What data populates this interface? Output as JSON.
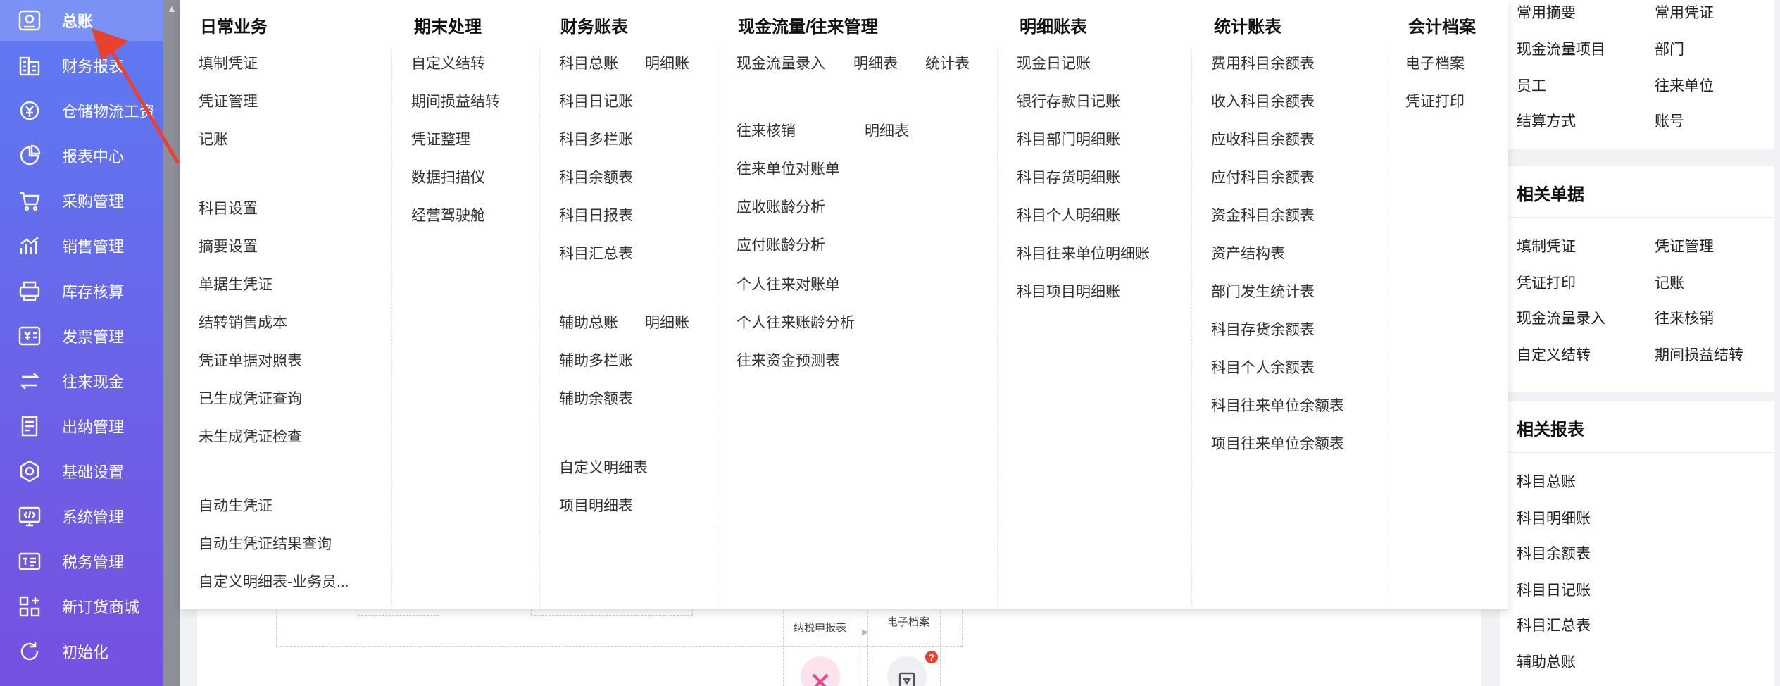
{
  "sidebar": {
    "items": [
      {
        "label": "总账",
        "icon": "ledger-icon"
      },
      {
        "label": "财务报表",
        "icon": "building-icon"
      },
      {
        "label": "仓储物流工资",
        "icon": "yen-gear-icon"
      },
      {
        "label": "报表中心",
        "icon": "pie-chart-icon"
      },
      {
        "label": "采购管理",
        "icon": "cart-icon"
      },
      {
        "label": "销售管理",
        "icon": "trend-chart-icon"
      },
      {
        "label": "库存核算",
        "icon": "printer-icon"
      },
      {
        "label": "发票管理",
        "icon": "invoice-icon"
      },
      {
        "label": "往来现金",
        "icon": "exchange-icon"
      },
      {
        "label": "出纳管理",
        "icon": "document-icon"
      },
      {
        "label": "基础设置",
        "icon": "gear-icon"
      },
      {
        "label": "系统管理",
        "icon": "monitor-code-icon"
      },
      {
        "label": "税务管理",
        "icon": "tax-icon"
      },
      {
        "label": "新订货商城",
        "icon": "apps-plus-icon"
      },
      {
        "label": "初始化",
        "icon": "refresh-icon"
      }
    ],
    "active_color": "#5d7cf3",
    "end_color": "#7650e0"
  },
  "mega_menu": {
    "daily": {
      "title": "日常业务",
      "links": [
        "填制凭证",
        "凭证管理",
        "记账",
        "科目设置",
        "摘要设置",
        "单据生凭证",
        "结转销售成本",
        "凭证单据对照表",
        "已生成凭证查询",
        "未生成凭证检查",
        "自动生凭证",
        "自动生凭证结果查询",
        "自定义明细表-业务员..."
      ]
    },
    "period_end": {
      "title": "期末处理",
      "links": [
        "自定义结转",
        "期间损益结转",
        "凭证整理",
        "数据扫描仪",
        "经营驾驶舱"
      ]
    },
    "fin_books": {
      "title": "财务账表",
      "links": [
        "科目总账",
        "明细账",
        "科目日记账",
        "科目多栏账",
        "科目余额表",
        "科目日报表",
        "科目汇总表",
        "辅助总账",
        "明细账",
        "辅助多栏账",
        "辅助余额表",
        "自定义明细表",
        "项目明细表"
      ]
    },
    "cashflow": {
      "title": "现金流量/往来管理",
      "links": [
        "现金流量录入",
        "明细表",
        "统计表",
        "往来核销",
        "明细表",
        "往来单位对账单",
        "应收账龄分析",
        "应付账龄分析",
        "个人往来对账单",
        "个人往来账龄分析",
        "往来资金预测表"
      ]
    },
    "detail_books": {
      "title": "明细账表",
      "links": [
        "现金日记账",
        "银行存款日记账",
        "科目部门明细账",
        "科目存货明细账",
        "科目个人明细账",
        "科目往来单位明细账",
        "科目项目明细账"
      ]
    },
    "stats": {
      "title": "统计账表",
      "links": [
        "费用科目余额表",
        "收入科目余额表",
        "应收科目余额表",
        "应付科目余额表",
        "资金科目余额表",
        "资产结构表",
        "部门发生统计表",
        "科目存货余额表",
        "科目个人余额表",
        "科目往来单位余额表",
        "项目往来单位余额表"
      ]
    },
    "archives": {
      "title": "会计档案",
      "links": [
        "电子档案",
        "凭证打印"
      ]
    }
  },
  "right_panel": {
    "top_links": [
      "常用摘要",
      "常用凭证",
      "现金流量项目",
      "部门",
      "员工",
      "往来单位",
      "结算方式",
      "账号"
    ],
    "related_docs": {
      "title": "相关单据",
      "links": [
        "填制凭证",
        "凭证管理",
        "凭证打印",
        "记账",
        "现金流量录入",
        "往来核销",
        "自定义结转",
        "期间损益结转"
      ]
    },
    "related_reports": {
      "title": "相关报表",
      "links": [
        "科目总账",
        "科目明细账",
        "科目余额表",
        "科目日记账",
        "科目汇总表",
        "辅助总账"
      ]
    }
  },
  "flow": {
    "tax_label": "纳税申报表",
    "archive_label": "电子档案",
    "alert_badge": "?"
  },
  "annotation": {
    "arrow_color": "#e8412e"
  }
}
